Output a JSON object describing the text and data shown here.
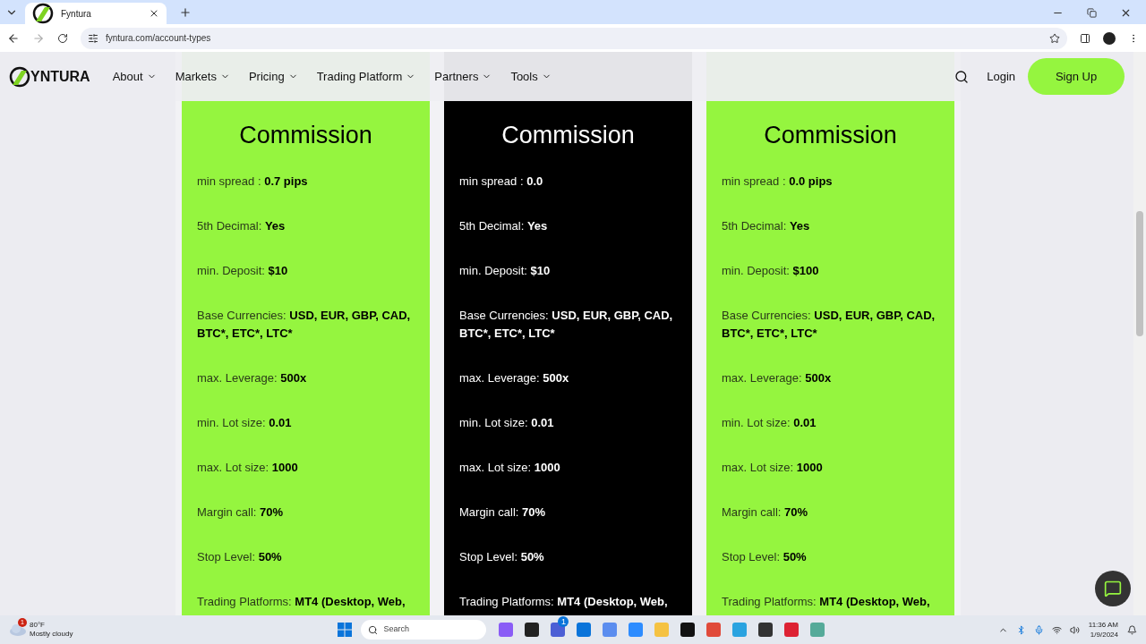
{
  "browser": {
    "tab_title": "Fyntura",
    "url": "fyntura.com/account-types"
  },
  "nav": {
    "logo": "YNTURA",
    "items": [
      "About",
      "Markets",
      "Pricing",
      "Trading Platform",
      "Partners",
      "Tools"
    ],
    "login": "Login",
    "signup": "Sign Up"
  },
  "cards": [
    {
      "kind": "green",
      "title": "Commission",
      "rows": [
        {
          "label": "min spread : ",
          "value": "0.7 pips"
        },
        {
          "label": "5th Decimal: ",
          "value": "Yes"
        },
        {
          "label": "min. Deposit: ",
          "value": "$10"
        },
        {
          "label": "Base Currencies: ",
          "value": "USD, EUR, GBP, CAD, BTC*, ETC*, LTC*"
        },
        {
          "label": "max. Leverage: ",
          "value": "500x"
        },
        {
          "label": "min. Lot size: ",
          "value": "0.01"
        },
        {
          "label": "max. Lot size: ",
          "value": "1000"
        },
        {
          "label": "Margin call: ",
          "value": "70%"
        },
        {
          "label": "Stop Level: ",
          "value": "50%"
        },
        {
          "label": "Trading Platforms: ",
          "value": "MT4 (Desktop, Web,"
        }
      ]
    },
    {
      "kind": "black",
      "title": "Commission",
      "rows": [
        {
          "label": "min spread : ",
          "value": "0.0"
        },
        {
          "label": "5th Decimal: ",
          "value": "Yes"
        },
        {
          "label": "min. Deposit: ",
          "value": "$10"
        },
        {
          "label": "Base Currencies: ",
          "value": "USD, EUR, GBP, CAD, BTC*, ETC*, LTC*"
        },
        {
          "label": "max. Leverage: ",
          "value": "500x"
        },
        {
          "label": "min. Lot size: ",
          "value": "0.01"
        },
        {
          "label": "max. Lot size: ",
          "value": "1000"
        },
        {
          "label": "Margin call: ",
          "value": "70%"
        },
        {
          "label": "Stop Level: ",
          "value": "50%"
        },
        {
          "label": "Trading Platforms: ",
          "value": "MT4 (Desktop, Web,"
        }
      ]
    },
    {
      "kind": "green",
      "title": "Commission",
      "rows": [
        {
          "label": "min spread : ",
          "value": "0.0 pips"
        },
        {
          "label": "5th Decimal: ",
          "value": "Yes"
        },
        {
          "label": "min. Deposit: ",
          "value": "$100"
        },
        {
          "label": "Base Currencies: ",
          "value": "USD, EUR, GBP, CAD, BTC*, ETC*, LTC*"
        },
        {
          "label": "max. Leverage: ",
          "value": "500x"
        },
        {
          "label": "min. Lot size: ",
          "value": "0.01"
        },
        {
          "label": "max. Lot size: ",
          "value": "1000"
        },
        {
          "label": "Margin call: ",
          "value": "70%"
        },
        {
          "label": "Stop Level: ",
          "value": "50%"
        },
        {
          "label": "Trading Platforms: ",
          "value": "MT4 (Desktop, Web,"
        }
      ]
    }
  ],
  "taskbar": {
    "weather_badge": "1",
    "temperature": "80°F",
    "weather": "Mostly cloudy",
    "search": "Search",
    "teams_badge": "1",
    "time": "11:36 AM",
    "date": "1/9/2024"
  }
}
